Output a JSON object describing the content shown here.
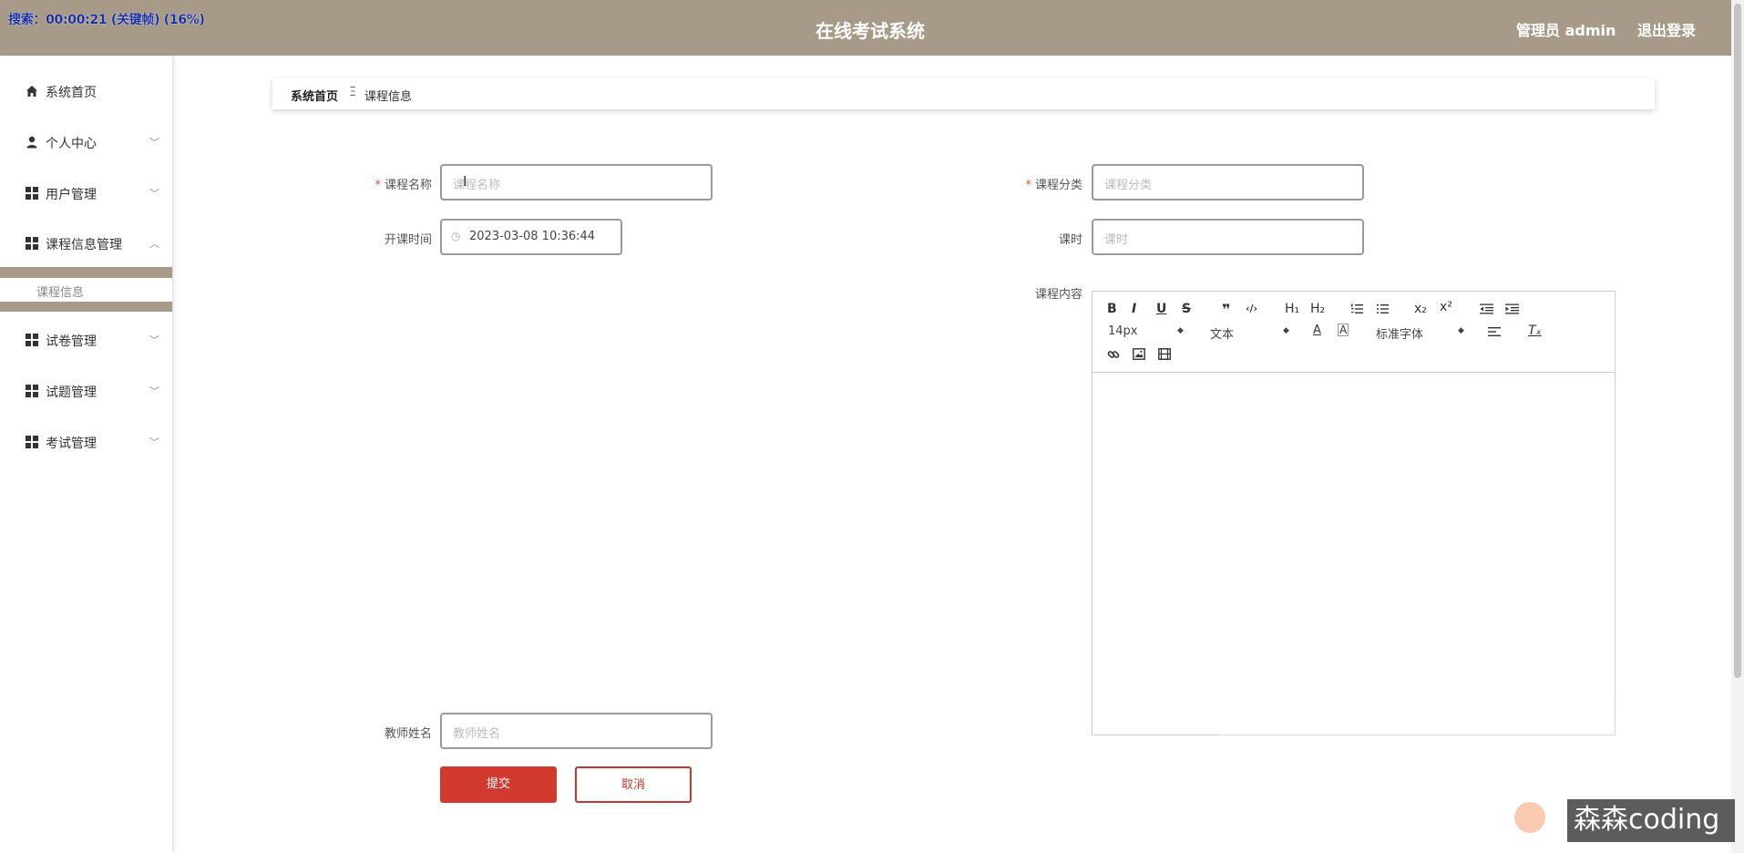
{
  "recorder": {
    "text": "搜索：00:00:21 (关键帧) (16%)"
  },
  "header": {
    "title": "在线考试系统",
    "user": "管理员 admin",
    "logout": "退出登录"
  },
  "sidebar": {
    "items": [
      {
        "label": "系统首页",
        "icon": "home-icon"
      },
      {
        "label": "个人中心",
        "icon": "user-icon"
      },
      {
        "label": "用户管理",
        "icon": "grid-icon"
      },
      {
        "label": "课程信息管理",
        "icon": "grid-icon"
      },
      {
        "label": "试卷管理",
        "icon": "grid-icon"
      },
      {
        "label": "试题管理",
        "icon": "grid-icon"
      },
      {
        "label": "考试管理",
        "icon": "grid-icon"
      }
    ],
    "subitem": "课程信息"
  },
  "breadcrumb": {
    "home": "系统首页",
    "separator": "Ξ",
    "current": "课程信息"
  },
  "form": {
    "course_name": {
      "label": "课程名称",
      "placeholder": "课程名称",
      "required": "*"
    },
    "course_category": {
      "label": "课程分类",
      "placeholder": "课程分类",
      "required": "*"
    },
    "start_time": {
      "label": "开课时间",
      "value": "2023-03-08 10:36:44"
    },
    "hours": {
      "label": "课时",
      "placeholder": "课时"
    },
    "content": {
      "label": "课程内容"
    },
    "teacher": {
      "label": "教师姓名",
      "placeholder": "教师姓名"
    }
  },
  "editor": {
    "font_size": "14px",
    "paragraph": "文本",
    "font_family": "标准字体",
    "buttons": {
      "bold": "B",
      "italic": "I",
      "underline": "U",
      "strike": "S",
      "quote": "❞",
      "code": "‹/›",
      "h1": "H₁",
      "h2": "H₂",
      "sub": "x₂",
      "sup": "x²",
      "clear": "Tₓ",
      "color": "A",
      "bg": "A"
    }
  },
  "actions": {
    "submit": "提交",
    "cancel": "取消"
  },
  "watermark": "森森coding",
  "colors": {
    "header": "#a79a88",
    "primary": "#d33a2f"
  }
}
